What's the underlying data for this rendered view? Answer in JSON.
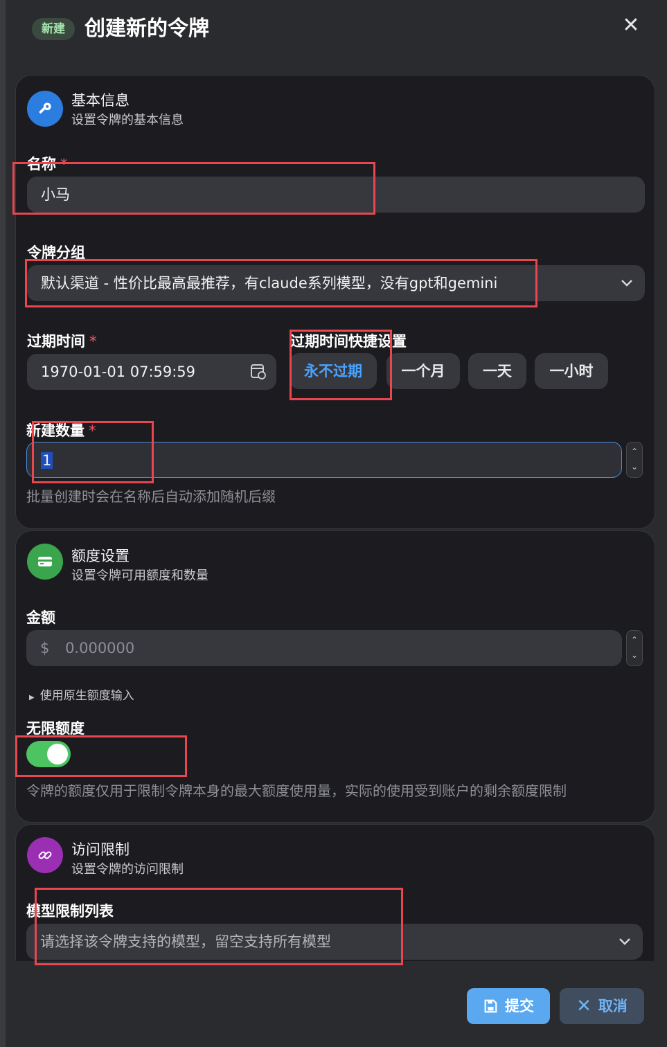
{
  "header": {
    "badge": "新建",
    "title": "创建新的令牌",
    "close": "✕"
  },
  "basic": {
    "title": "基本信息",
    "subtitle": "设置令牌的基本信息",
    "name_label": "名称",
    "name_value": "小马",
    "group_label": "令牌分组",
    "group_value": "默认渠道 - 性价比最高最推荐，有claude系列模型，没有gpt和gemini",
    "expire_label": "过期时间",
    "expire_value": "1970-01-01 07:59:59",
    "quick_label": "过期时间快捷设置",
    "quick_options": [
      "永不过期",
      "一个月",
      "一天",
      "一小时"
    ],
    "count_label": "新建数量",
    "count_value": "1",
    "count_help": "批量创建时会在名称后自动添加随机后缀"
  },
  "quota": {
    "title": "额度设置",
    "subtitle": "设置令牌可用额度和数量",
    "amount_label": "金额",
    "currency": "$",
    "amount_placeholder": "0.000000",
    "raw_input": "使用原生额度输入",
    "unlimited_label": "无限额度",
    "unlimited_help": "令牌的额度仅用于限制令牌本身的最大额度使用量，实际的使用受到账户的剩余额度限制"
  },
  "access": {
    "title": "访问限制",
    "subtitle": "设置令牌的访问限制",
    "models_label": "模型限制列表",
    "models_placeholder": "请选择该令牌支持的模型，留空支持所有模型"
  },
  "footer": {
    "submit": "提交",
    "cancel": "取消"
  },
  "required_mark": "*",
  "colors": {
    "accent": "#4aa3ff",
    "success": "#4cc461",
    "highlight": "#e8474f"
  }
}
